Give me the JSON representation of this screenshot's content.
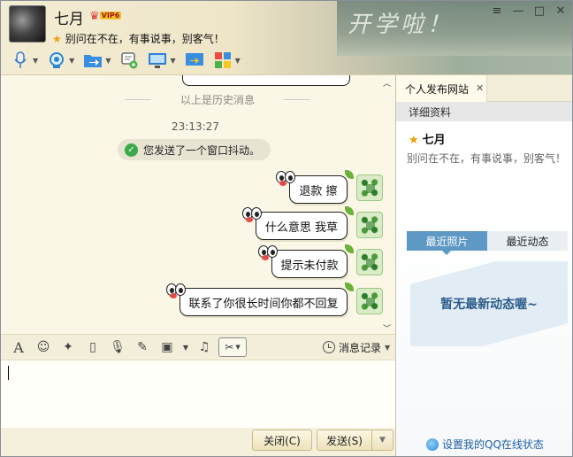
{
  "header": {
    "nickname": "七月",
    "vip_label": "VIP6",
    "signature": "别问在不在，有事说事，别客气！",
    "skin_text": "开学啦！",
    "window_buttons": [
      "≡",
      "—",
      "□",
      "✕"
    ]
  },
  "toolbar": {
    "icons": [
      "microphone-icon",
      "camera-icon",
      "folder-transfer-icon",
      "sms-icon",
      "remote-desktop-icon",
      "screen-share-icon",
      "apps-icon"
    ]
  },
  "chat": {
    "history_label": "以上是历史消息",
    "timestamp": "23:13:27",
    "shake_notice": "您发送了一个窗口抖动。",
    "messages": [
      {
        "text": "退款 擦"
      },
      {
        "text": "什么意思 我草"
      },
      {
        "text": "提示未付款"
      },
      {
        "text": "联系了你很长时间你都不回复"
      }
    ]
  },
  "format_toolbar": {
    "font_label": "A",
    "history_button": "消息记录"
  },
  "actions": {
    "close_label": "关闭(C)",
    "send_label": "发送(S)"
  },
  "side_panel": {
    "tab_title": "个人发布网站",
    "section_header": "详细资料",
    "name": "七月",
    "signature": "别问在不在，有事说事，别客气！",
    "tabs": [
      "最近照片",
      "最近动态"
    ],
    "empty_text": "暂无最新动态喔~",
    "status_link": "设置我的QQ在线状态"
  },
  "colors": {
    "accent_blue": "#5e98c4",
    "link_blue": "#1e5fa8",
    "chat_bg": "#fbf7e6"
  }
}
